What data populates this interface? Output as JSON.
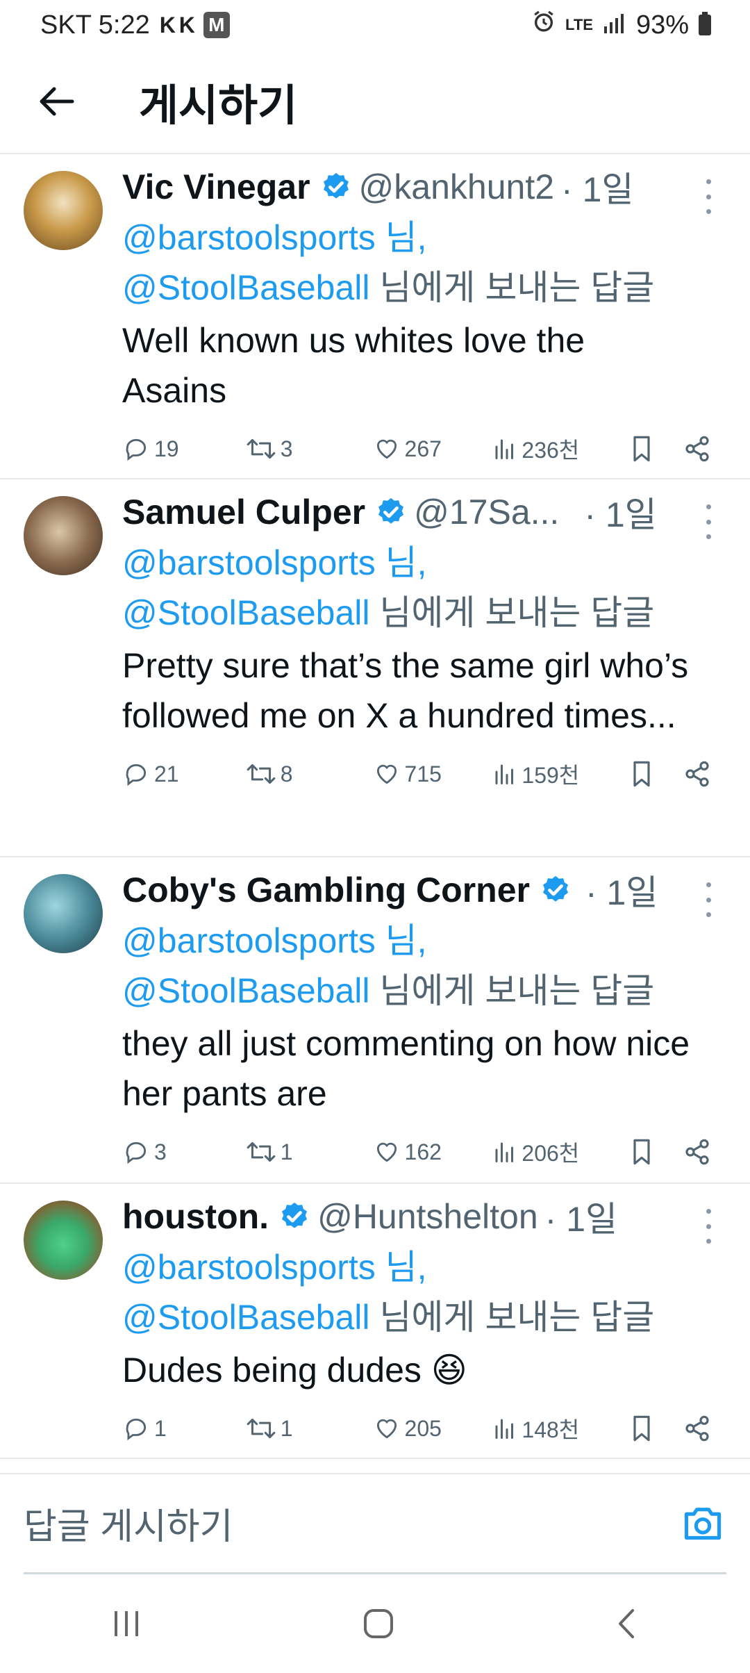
{
  "status_bar": {
    "carrier_time": "SKT 5:22",
    "mini_icons": "K K",
    "m_badge": "M",
    "network": "LTE",
    "battery": "93%"
  },
  "header": {
    "title": "게시하기"
  },
  "tweets": [
    {
      "name": "Vic Vinegar",
      "handle": "@kankhunt2",
      "time": "· 1일",
      "mention1": "@barstoolsports 님,",
      "mention2": "@StoolBaseball",
      "reply_suffix": " 님에게 보내는 답글",
      "text": "Well known us whites love the Asains",
      "replies": "19",
      "retweets": "3",
      "likes": "267",
      "views": "236천",
      "avatar_color": "#c99a4a"
    },
    {
      "name": "Samuel Culper",
      "handle": "@17Sa...",
      "time": "· 1일",
      "mention1": "@barstoolsports 님,",
      "mention2": "@StoolBaseball",
      "reply_suffix": " 님에게 보내는 답글",
      "text": "Pretty sure that’s the same girl who’s followed me on X a hundred times...",
      "replies": "21",
      "retweets": "8",
      "likes": "715",
      "views": "159천",
      "avatar_color": "#8a6a4e"
    },
    {
      "name": "Coby's Gambling Corner",
      "handle": "",
      "time": "· 1일",
      "mention1": "@barstoolsports 님,",
      "mention2": "@StoolBaseball",
      "reply_suffix": " 님에게 보내는 답글",
      "text": "they all just commenting on how nice her pants are",
      "replies": "3",
      "retweets": "1",
      "likes": "162",
      "views": "206천",
      "avatar_color": "#4a8a9a"
    },
    {
      "name": "houston.",
      "handle": "@Huntshelton",
      "time": "· 1일",
      "mention1": "@barstoolsports 님,",
      "mention2": "@StoolBaseball",
      "reply_suffix": " 님에게 보내는 답글",
      "text": "Dudes being dudes 😆",
      "replies": "1",
      "retweets": "1",
      "likes": "205",
      "views": "148천",
      "avatar_color": "#4fd18a"
    }
  ],
  "compose": {
    "placeholder": "답글 게시하기"
  },
  "colors": {
    "accent": "#1d9bf0",
    "secondary_text": "#536471",
    "divider": "#e6e9ec"
  }
}
